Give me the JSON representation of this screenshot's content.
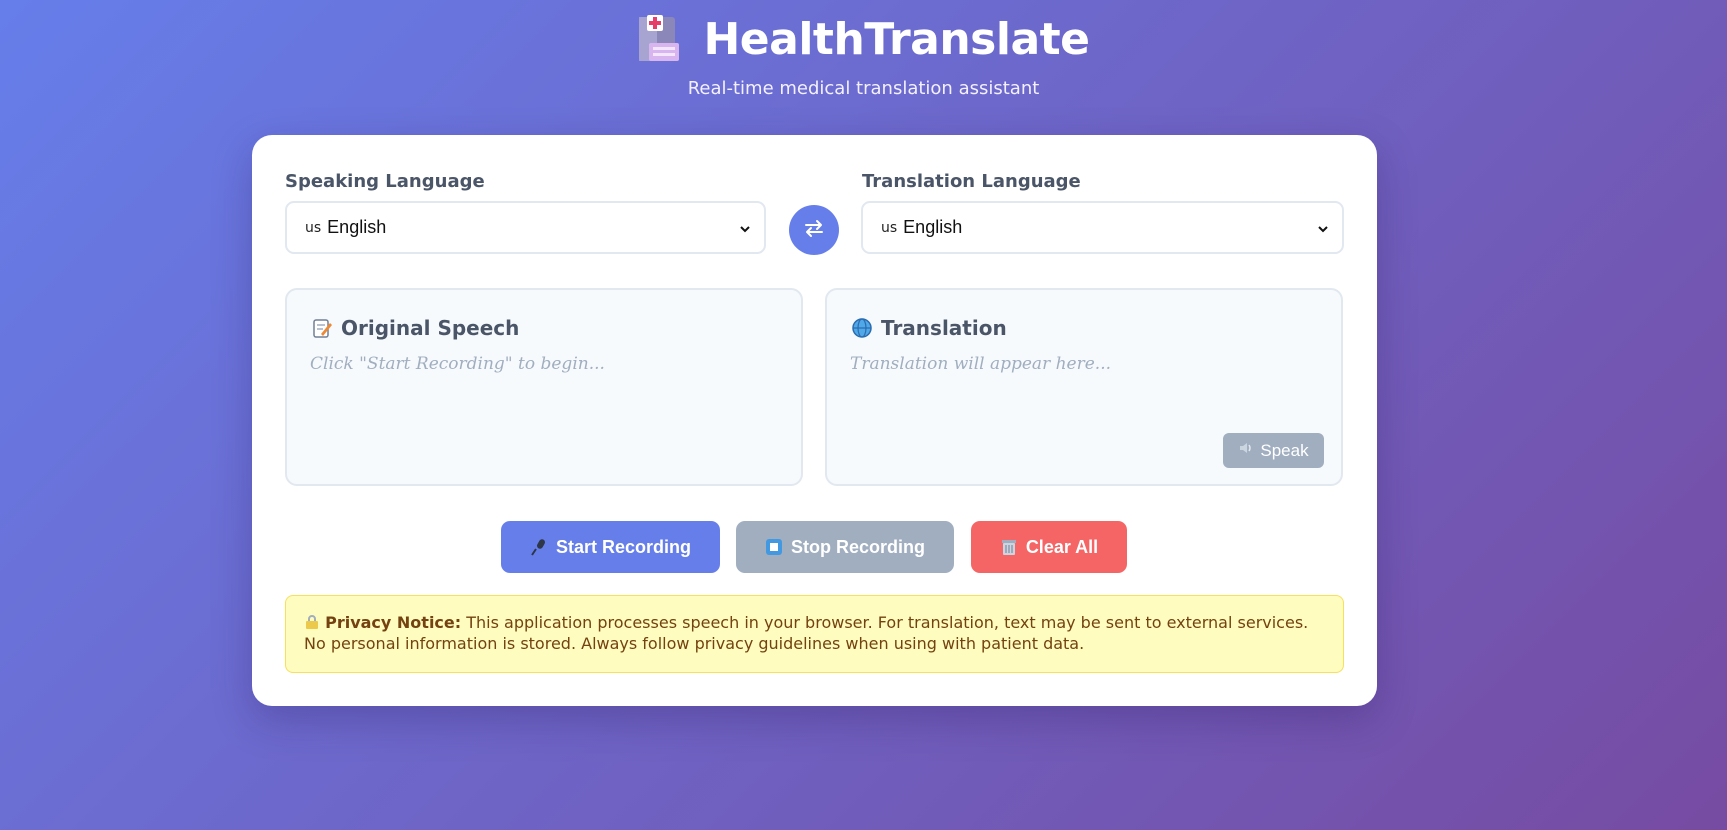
{
  "header": {
    "logo_icon": "hospital-icon",
    "title": "HealthTranslate",
    "subtitle": "Real-time medical translation assistant"
  },
  "languages": {
    "speaking_label": "Speaking Language",
    "speaking_flag": "us",
    "speaking_value": "English",
    "translation_label": "Translation Language",
    "translation_flag": "us",
    "translation_value": "English",
    "swap_icon": "swap-arrows-icon"
  },
  "panels": {
    "original_icon": "memo-icon",
    "original_title": "Original Speech",
    "original_placeholder": "Click \"Start Recording\" to begin...",
    "translation_icon": "globe-icon",
    "translation_title": "Translation",
    "translation_placeholder": "Translation will appear here...",
    "speak_label": "Speak",
    "speak_icon": "speaker-icon"
  },
  "actions": {
    "start_label": "Start Recording",
    "start_icon": "microphone-icon",
    "stop_label": "Stop Recording",
    "stop_icon": "stop-icon",
    "clear_label": "Clear All",
    "clear_icon": "trash-icon"
  },
  "notice": {
    "icon": "lock-icon",
    "heading": "Privacy Notice:",
    "body": " This application processes speech in your browser. For translation, text may be sent to external services. No personal information is stored. Always follow privacy guidelines when using with patient data."
  },
  "colors": {
    "primary": "#667eea",
    "disabled": "#a0aec0",
    "danger": "#f56565",
    "notice_bg": "#fefcbf"
  }
}
